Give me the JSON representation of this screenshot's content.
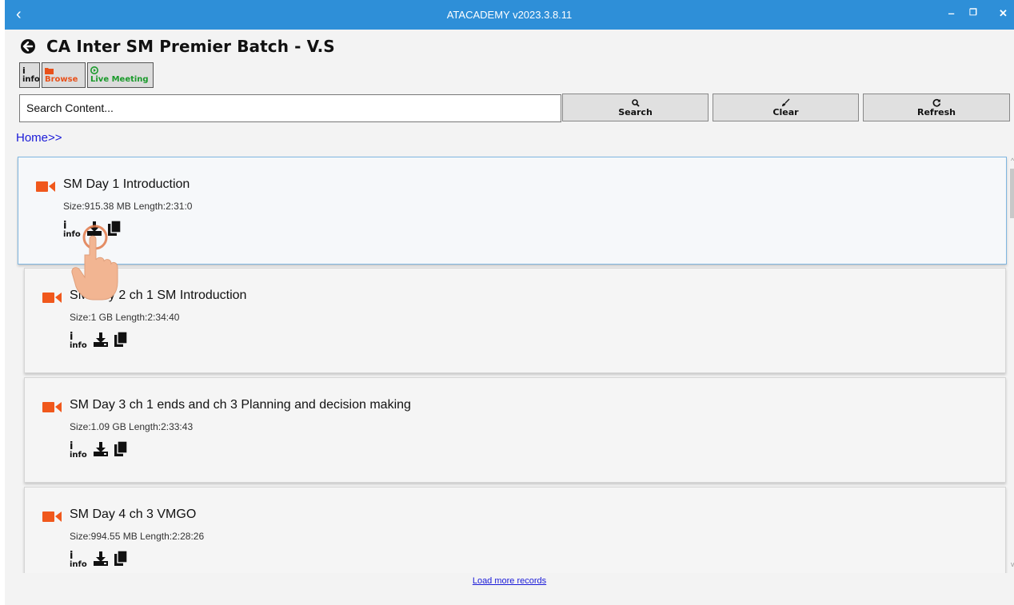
{
  "window": {
    "title": "ATACADEMY v2023.3.8.11",
    "back_glyph": "‹",
    "min_glyph": "‒",
    "max_glyph": "❐",
    "close_glyph": "✕"
  },
  "header": {
    "title": "CA Inter SM Premier Batch - V.S"
  },
  "toolbar": {
    "info_label": "info",
    "browse_label": "Browse",
    "live_label": "Live Meeting"
  },
  "search": {
    "placeholder": "Search Content...",
    "value": "",
    "search_label": "Search",
    "clear_label": "Clear",
    "refresh_label": "Refresh"
  },
  "breadcrumb": "Home>>",
  "colors": {
    "titlebar": "#2e8fd8",
    "video_icon": "#f0581c",
    "link": "#1a1ad8",
    "live_green": "#1a9a2b"
  },
  "items": [
    {
      "name": "SM Day 1 Introduction",
      "meta": "Size:915.38 MB  Length:2:31:0",
      "icon": "video-camera-icon",
      "selected": true
    },
    {
      "name": "SM Day 2 ch 1 SM Introduction",
      "meta": "Size:1 GB  Length:2:34:40",
      "icon": "video-camera-icon",
      "selected": false
    },
    {
      "name": "SM Day 3 ch 1 ends and ch 3 Planning and decision making",
      "meta": "Size:1.09 GB  Length:2:33:43",
      "icon": "video-camera-icon",
      "selected": false
    },
    {
      "name": "SM Day 4 ch 3 VMGO",
      "meta": "Size:994.55 MB  Length:2:28:26",
      "icon": "video-camera-icon",
      "selected": false
    }
  ],
  "item_action_info_label": "info",
  "item_action_info_glyph": "i",
  "load_more": "Load more records"
}
